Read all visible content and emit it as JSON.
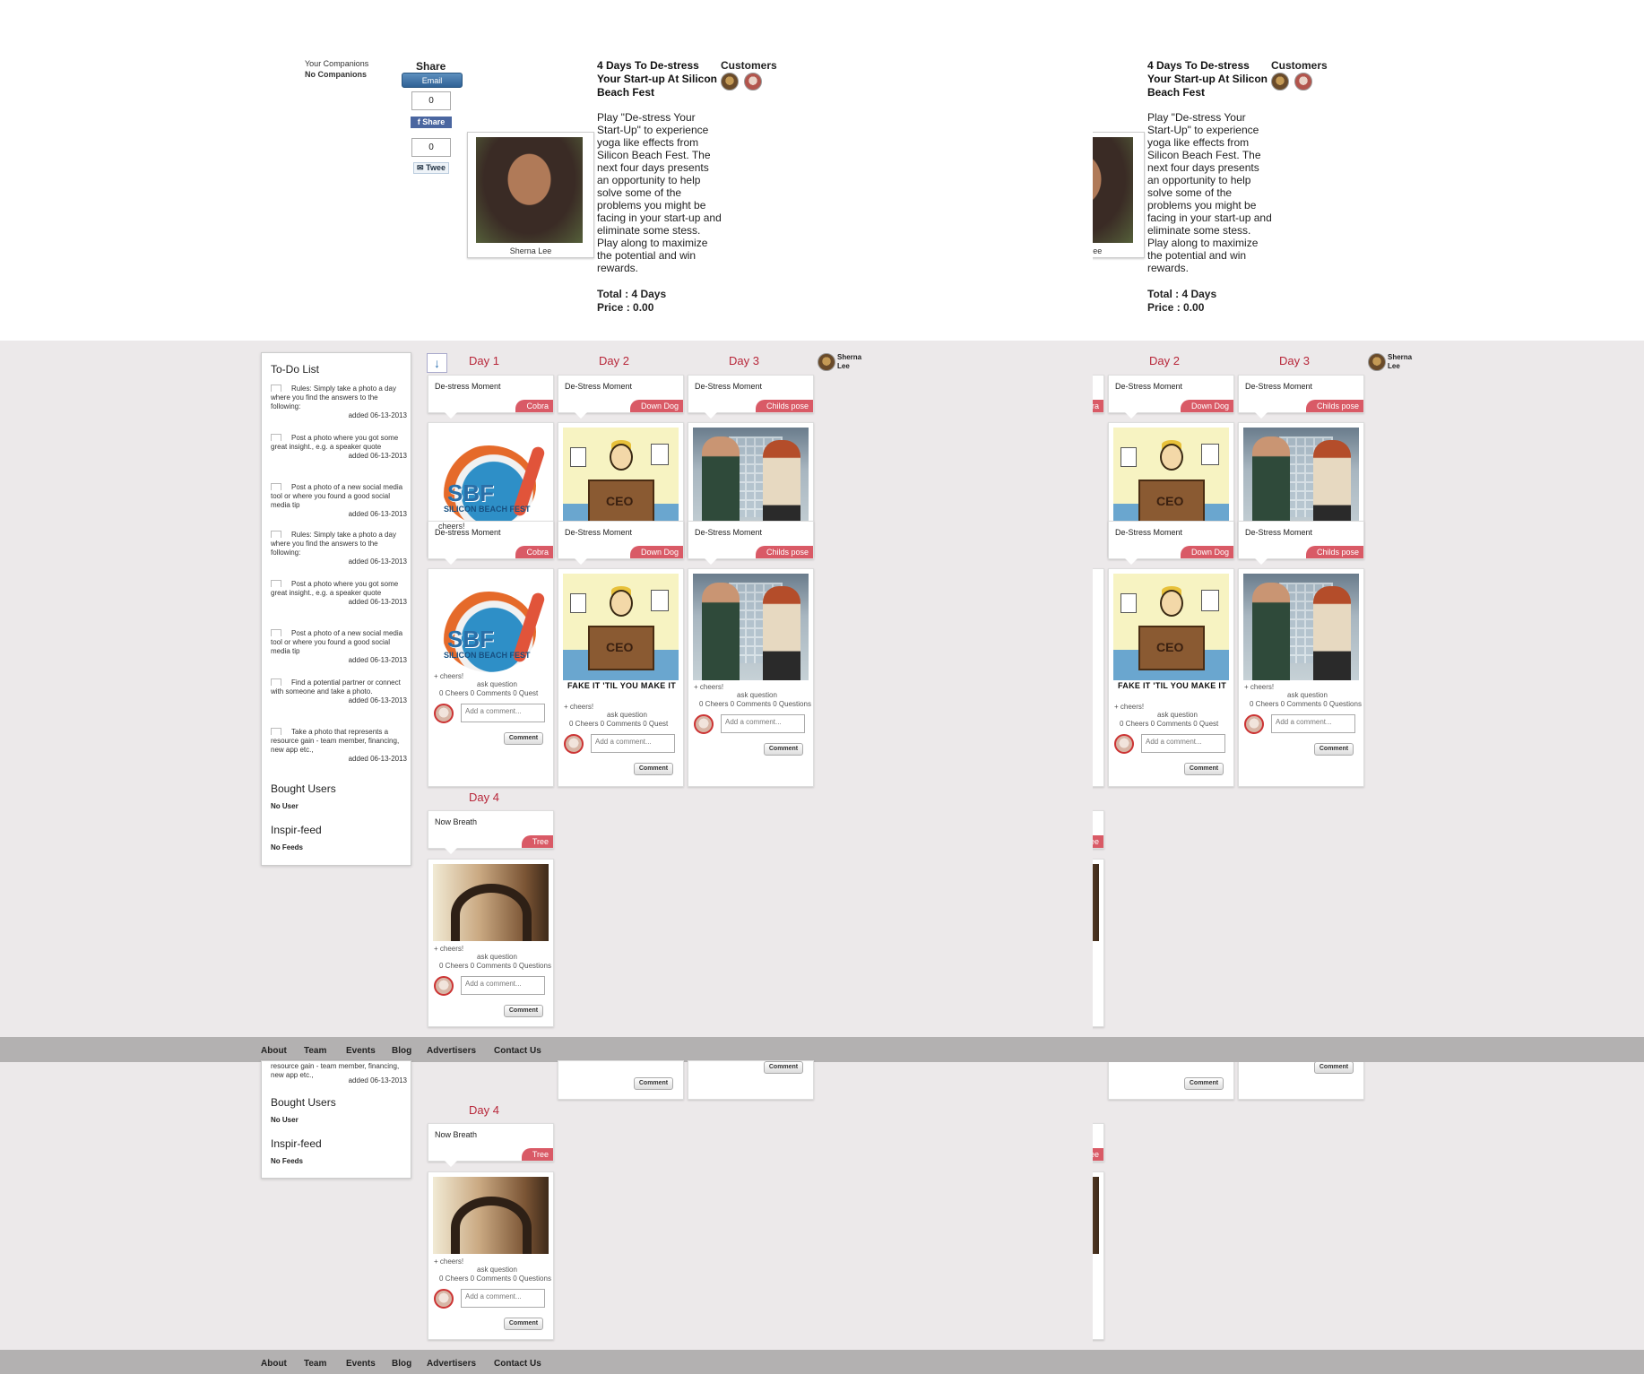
{
  "companions": {
    "title": "Your Companions",
    "value": "No Companions"
  },
  "share": {
    "title": "Share",
    "email_label": "Email",
    "fb_count": "0",
    "fb_label": "Share",
    "tw_count": "0",
    "tw_label": "Twee"
  },
  "profile": {
    "name": "Sherna Lee"
  },
  "event": {
    "title": "4 Days To De-stress Your Start-up At Silicon Beach Fest",
    "description": "Play \"De-stress Your Start-Up\" to experience yoga like effects from Silicon Beach Fest. The next four days presents an opportunity to help solve some of the problems you might be facing in your start-up and eliminate some stess. Play along to maximize the potential and win rewards.",
    "total": "Total : 4 Days",
    "price": "Price : 0.00"
  },
  "customers": {
    "title": "Customers"
  },
  "sidebar": {
    "todo_title": "To-Do List",
    "todo_items": [
      {
        "text": "Rules: Simply take a photo a day where you find the answers to the following:",
        "date": "added 06-13-2013"
      },
      {
        "text": "Post a photo where you got some great insight., e.g. a speaker quote",
        "date": "added 06-13-2013"
      },
      {
        "text": "Post a photo of a new social media tool or where you found a good social media tip",
        "date": "added 06-13-2013"
      },
      {
        "text": "Rules: Simply take a photo a day where you find the answers to the following:",
        "date": "added 06-13-2013"
      },
      {
        "text": "Post a photo where you got some great insight., e.g. a speaker quote",
        "date": "added 06-13-2013"
      },
      {
        "text": "Post a photo of a new social media tool or where you found a good social media tip",
        "date": "added 06-13-2013"
      },
      {
        "text": "Find a potential partner or connect with someone and take a photo.",
        "date": "added 06-13-2013"
      },
      {
        "text": "Take a photo that represents a resource gain - team member, financing, new app etc.,",
        "date": "added 06-13-2013"
      }
    ],
    "bought_title": "Bought Users",
    "bought_value": "No User",
    "feed_title": "Inspir-feed",
    "feed_value": "No Feeds",
    "partial_text": "resource gain - team member, financing, new app etc.,",
    "partial_date": "added 06-13-2013"
  },
  "owner": {
    "name": "Sherna Lee"
  },
  "days": [
    {
      "label": "Day 1",
      "moment": "De-stress Moment",
      "tag": "Cobra"
    },
    {
      "label": "Day 2",
      "moment": "De-Stress Moment",
      "tag": "Down Dog"
    },
    {
      "label": "Day 3",
      "moment": "De-Stress Moment",
      "tag": "Childs pose"
    },
    {
      "label": "Day 4",
      "moment": "Now Breath",
      "tag": "Tree"
    }
  ],
  "card": {
    "cheers": "+ cheers!",
    "ask": "ask question",
    "stats": "0 Cheers  0 Comments 0 Questions",
    "stats_short": "0 Cheers  0 Comments 0 Quest",
    "comment_placeholder": "Add a comment...",
    "comment_button": "Comment",
    "fake_caption": "FAKE IT 'TIL YOU MAKE IT",
    "overlay_1": "cheers!",
    "sbf_text": "SBF",
    "sbf_sub": "SILICON BEACH FEST",
    "ceo_text": "CEO",
    "right_fragment_1": "estions",
    "right_fragment_2": "est"
  },
  "footer": {
    "links": [
      "About",
      "Team",
      "Events",
      "Blog",
      "Advertisers",
      "Contact Us"
    ]
  }
}
